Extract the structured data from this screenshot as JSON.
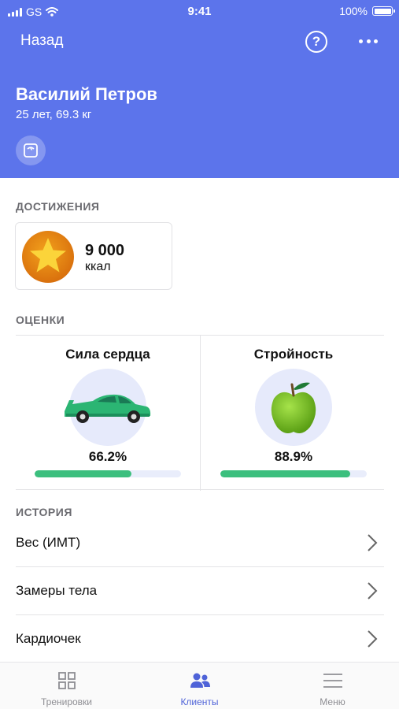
{
  "status_bar": {
    "carrier": "GS",
    "time": "9:41",
    "battery": "100%"
  },
  "nav": {
    "back_label": "Назад",
    "help_icon": "question-circle-icon",
    "more_icon": "ellipsis-icon"
  },
  "profile": {
    "name": "Василий Петров",
    "info": "25 лет, 69.3 кг",
    "action_icon": "scale-icon"
  },
  "colors": {
    "header": "#5c74eb",
    "progress": "#3cbf7e",
    "tab_active": "#4f63d8"
  },
  "achievements": {
    "title": "ДОСТИЖЕНИЯ",
    "items": [
      {
        "value": "9 000",
        "unit": "ккал",
        "icon": "star-medal-icon"
      }
    ]
  },
  "ratings": {
    "title": "ОЦЕНКИ",
    "items": [
      {
        "title": "Сила сердца",
        "value_label": "66.2%",
        "progress": 0.662,
        "icon": "sports-car-icon"
      },
      {
        "title": "Стройность",
        "value_label": "88.9%",
        "progress": 0.889,
        "icon": "green-apple-icon"
      }
    ]
  },
  "history": {
    "title": "ИСТОРИЯ",
    "items": [
      {
        "label": "Вес (ИМТ)"
      },
      {
        "label": "Замеры тела"
      },
      {
        "label": "Кардиочек"
      }
    ]
  },
  "tab_bar": {
    "items": [
      {
        "label": "Тренировки",
        "icon": "grid-icon",
        "active": false
      },
      {
        "label": "Клиенты",
        "icon": "people-icon",
        "active": true
      },
      {
        "label": "Меню",
        "icon": "menu-icon",
        "active": false
      }
    ]
  }
}
